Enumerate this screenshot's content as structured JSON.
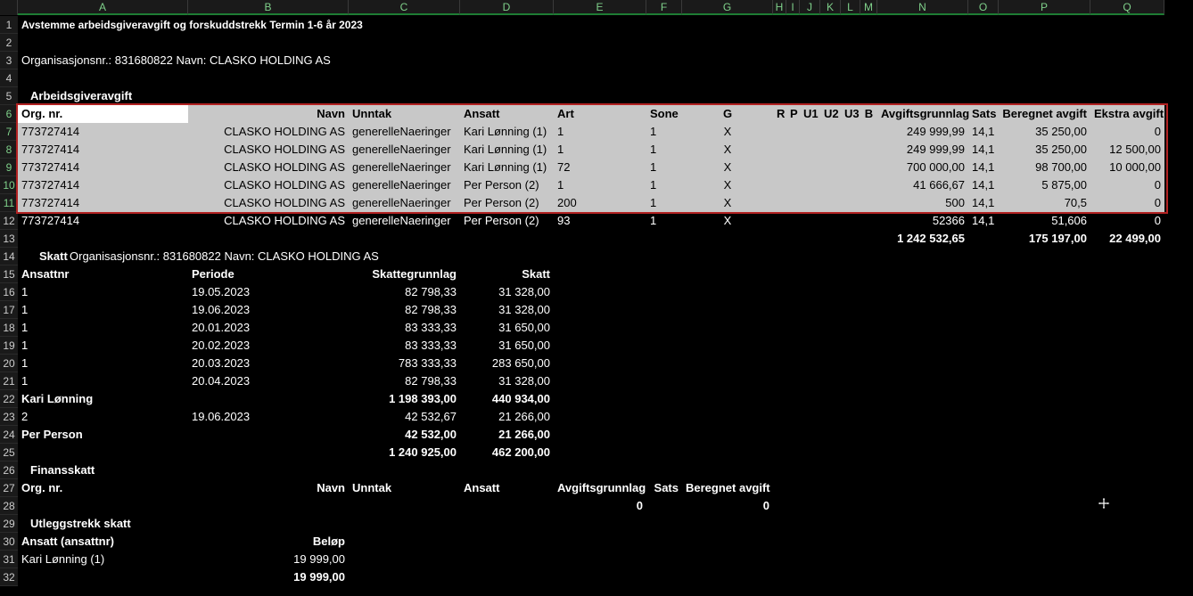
{
  "columns": [
    "A",
    "B",
    "C",
    "D",
    "E",
    "F",
    "G",
    "H",
    "I",
    "J",
    "K",
    "L",
    "M",
    "N",
    "O",
    "P",
    "Q"
  ],
  "rows": [
    "1",
    "2",
    "3",
    "4",
    "5",
    "6",
    "7",
    "8",
    "9",
    "10",
    "11",
    "12",
    "13",
    "14",
    "15",
    "16",
    "17",
    "18",
    "19",
    "20",
    "21",
    "22",
    "23",
    "24",
    "25",
    "26",
    "27",
    "28",
    "29",
    "30",
    "31",
    "32"
  ],
  "title": "Avstemme arbeidsgiveravgift og forskuddstrekk Termin 1-6 år 2023",
  "org_line": "Organisasjonsnr.: 831680822   Navn: CLASKO HOLDING AS",
  "aga": {
    "section": "Arbeidsgiveravgift",
    "headers": {
      "org": "Org. nr.",
      "navn": "Navn",
      "unntak": "Unntak",
      "ansatt": "Ansatt",
      "art": "Art",
      "sone": "Sone",
      "g": "G",
      "r": "R",
      "p": "P",
      "u1": "U1",
      "u2": "U2",
      "u3": "U3",
      "b": "B",
      "grunnlag": "Avgiftsgrunnlag",
      "sats": "Sats",
      "beregnet": "Beregnet avgift",
      "ekstra": "Ekstra avgift"
    },
    "rows": [
      {
        "org": "773727414",
        "navn": "CLASKO HOLDING AS",
        "unntak": "generelleNaeringer",
        "ansatt": "Kari Lønning (1)",
        "art": "1",
        "sone": "1",
        "g": "X",
        "grunnlag": "249 999,99",
        "sats": "14,1",
        "beregnet": "35 250,00",
        "ekstra": "0"
      },
      {
        "org": "773727414",
        "navn": "CLASKO HOLDING AS",
        "unntak": "generelleNaeringer",
        "ansatt": "Kari Lønning (1)",
        "art": "1",
        "sone": "1",
        "g": "X",
        "grunnlag": "249 999,99",
        "sats": "14,1",
        "beregnet": "35 250,00",
        "ekstra": "12 500,00"
      },
      {
        "org": "773727414",
        "navn": "CLASKO HOLDING AS",
        "unntak": "generelleNaeringer",
        "ansatt": "Kari Lønning (1)",
        "art": "72",
        "sone": "1",
        "g": "X",
        "grunnlag": "700 000,00",
        "sats": "14,1",
        "beregnet": "98 700,00",
        "ekstra": "10 000,00"
      },
      {
        "org": "773727414",
        "navn": "CLASKO HOLDING AS",
        "unntak": "generelleNaeringer",
        "ansatt": "Per Person (2)",
        "art": "1",
        "sone": "1",
        "g": "X",
        "grunnlag": "41 666,67",
        "sats": "14,1",
        "beregnet": "5 875,00",
        "ekstra": "0"
      },
      {
        "org": "773727414",
        "navn": "CLASKO HOLDING AS",
        "unntak": "generelleNaeringer",
        "ansatt": "Per Person (2)",
        "art": "200",
        "sone": "1",
        "g": "X",
        "grunnlag": "500",
        "sats": "14,1",
        "beregnet": "70,5",
        "ekstra": "0"
      },
      {
        "org": "773727414",
        "navn": "CLASKO HOLDING AS",
        "unntak": "generelleNaeringer",
        "ansatt": "Per Person (2)",
        "art": "93",
        "sone": "1",
        "g": "X",
        "grunnlag": "52366",
        "sats": "14,1",
        "beregnet": "51,606",
        "ekstra": "0"
      }
    ],
    "totals": {
      "grunnlag": "1 242 532,65",
      "beregnet": "175 197,00",
      "ekstra": "22 499,00"
    }
  },
  "skatt": {
    "section": "Skatt",
    "org_line": "Organisasjonsnr.: 831680822   Navn: CLASKO HOLDING AS",
    "headers": {
      "ansattnr": "Ansattnr",
      "periode": "Periode",
      "grunnlag": "Skattegrunnlag",
      "skatt": "Skatt"
    },
    "rows": [
      {
        "ansattnr": "1",
        "periode": "19.05.2023",
        "grunnlag": "82 798,33",
        "skatt": "31 328,00"
      },
      {
        "ansattnr": "1",
        "periode": "19.06.2023",
        "grunnlag": "82 798,33",
        "skatt": "31 328,00"
      },
      {
        "ansattnr": "1",
        "periode": "20.01.2023",
        "grunnlag": "83 333,33",
        "skatt": "31 650,00"
      },
      {
        "ansattnr": "1",
        "periode": "20.02.2023",
        "grunnlag": "83 333,33",
        "skatt": "31 650,00"
      },
      {
        "ansattnr": "1",
        "periode": "20.03.2023",
        "grunnlag": "783 333,33",
        "skatt": "283 650,00"
      },
      {
        "ansattnr": "1",
        "periode": "20.04.2023",
        "grunnlag": "82 798,33",
        "skatt": "31 328,00"
      }
    ],
    "sub1": {
      "name": "Kari Lønning",
      "grunnlag": "1 198 393,00",
      "skatt": "440 934,00"
    },
    "row2": {
      "ansattnr": "2",
      "periode": "19.06.2023",
      "grunnlag": "42 532,67",
      "skatt": "21 266,00"
    },
    "sub2": {
      "name": "Per Person",
      "grunnlag": "42 532,00",
      "skatt": "21 266,00"
    },
    "total": {
      "grunnlag": "1 240 925,00",
      "skatt": "462 200,00"
    }
  },
  "finans": {
    "section": "Finansskatt",
    "headers": {
      "org": "Org. nr.",
      "navn": "Navn",
      "unntak": "Unntak",
      "ansatt": "Ansatt",
      "grunnlag": "Avgiftsgrunnlag",
      "sats": "Sats",
      "beregnet": "Beregnet avgift"
    },
    "totals": {
      "grunnlag": "0",
      "beregnet": "0"
    }
  },
  "utlegg": {
    "section": "Utleggstrekk skatt",
    "headers": {
      "ansatt": "Ansatt (ansattnr)",
      "belop": "Beløp"
    },
    "rows": [
      {
        "ansatt": "Kari Lønning (1)",
        "belop": "19 999,00"
      }
    ],
    "total": "19 999,00"
  },
  "colors": {
    "selection_border": "#b22222",
    "selection_fill": "#c8c8c8",
    "header_accent": "#1e7c34"
  },
  "icons": {
    "cursor": "move-cursor-icon"
  }
}
